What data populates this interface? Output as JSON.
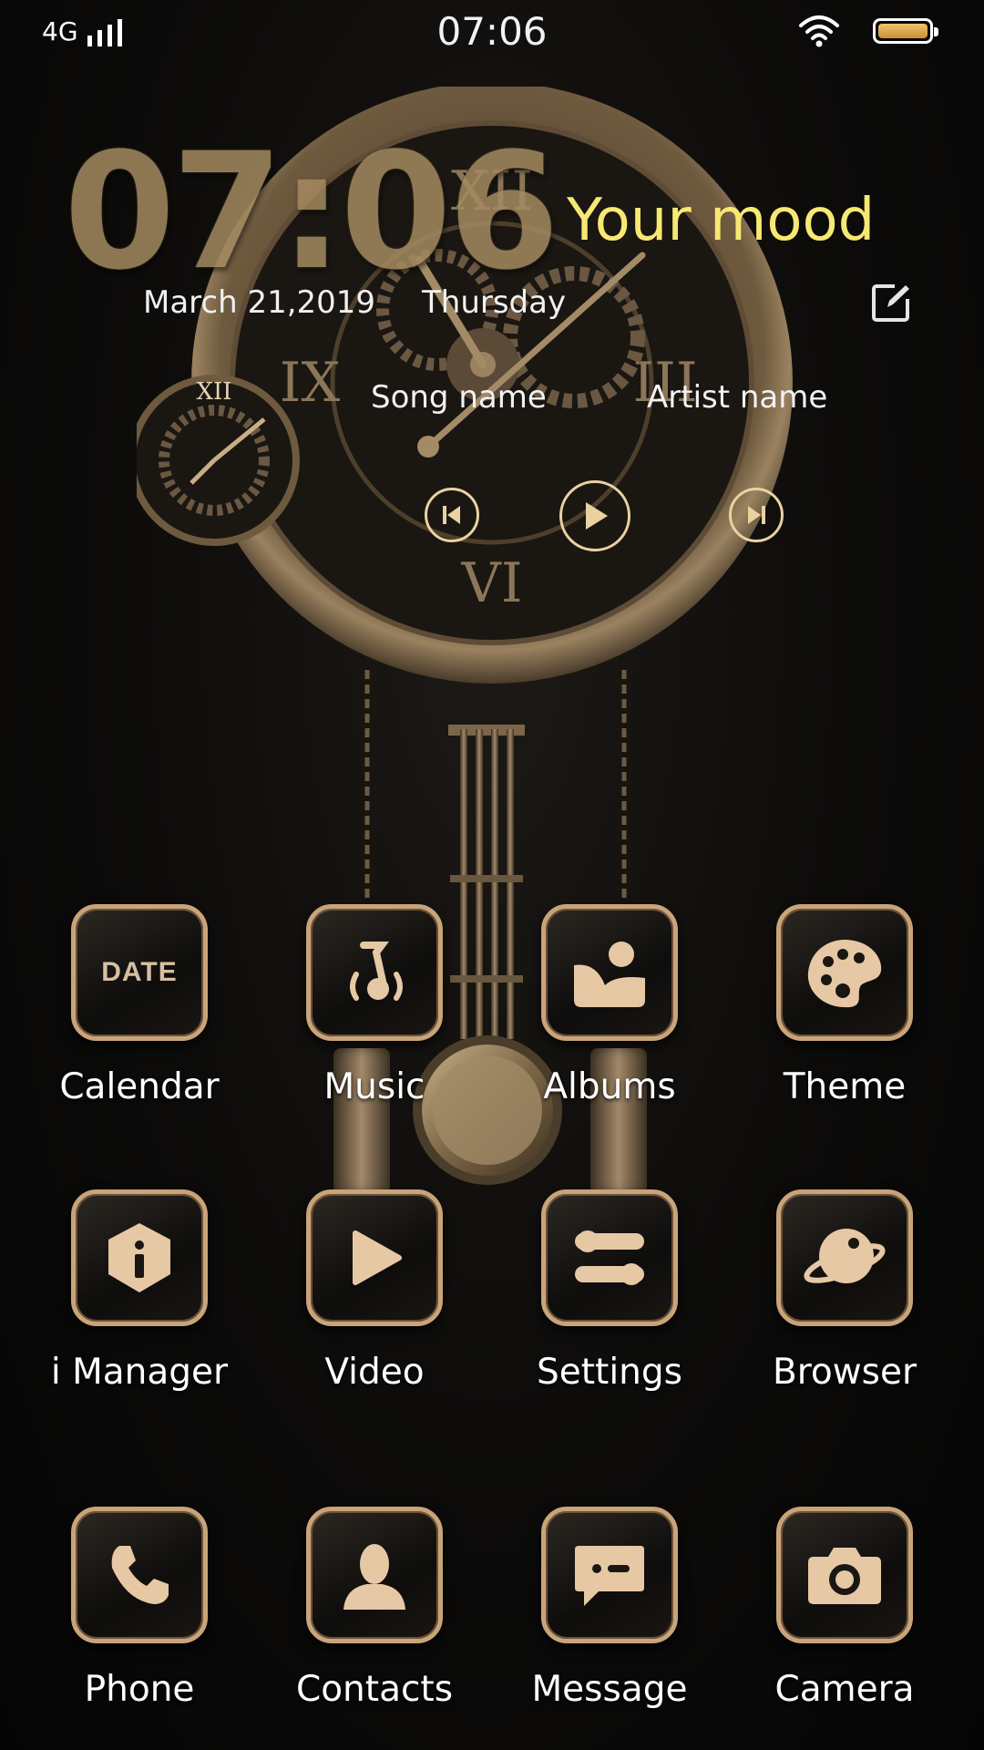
{
  "status_bar": {
    "network": "4G",
    "time": "07:06"
  },
  "clock_widget": {
    "time": "07:06",
    "mood": "Your mood",
    "date": "March 21,2019",
    "weekday": "Thursday",
    "dial_numeral": "XII"
  },
  "music_widget": {
    "song": "Song name",
    "artist": "Artist name"
  },
  "apps": [
    {
      "label": "Calendar",
      "icon": "calendar-icon",
      "icon_text": "DATE"
    },
    {
      "label": "Music",
      "icon": "music-note-icon"
    },
    {
      "label": "Albums",
      "icon": "photo-album-icon"
    },
    {
      "label": "Theme",
      "icon": "paint-palette-icon"
    },
    {
      "label": "i Manager",
      "icon": "shield-info-icon"
    },
    {
      "label": "Video",
      "icon": "play-icon"
    },
    {
      "label": "Settings",
      "icon": "toggle-sliders-icon"
    },
    {
      "label": "Browser",
      "icon": "planet-icon"
    },
    {
      "label": "Phone",
      "icon": "phone-handset-icon"
    },
    {
      "label": "Contacts",
      "icon": "person-icon"
    },
    {
      "label": "Message",
      "icon": "chat-bubble-icon"
    },
    {
      "label": "Camera",
      "icon": "camera-icon"
    }
  ],
  "colors": {
    "accent_gold": "#c9a47a",
    "mood_yellow": "#f7e873",
    "background": "#0c0b0a"
  }
}
